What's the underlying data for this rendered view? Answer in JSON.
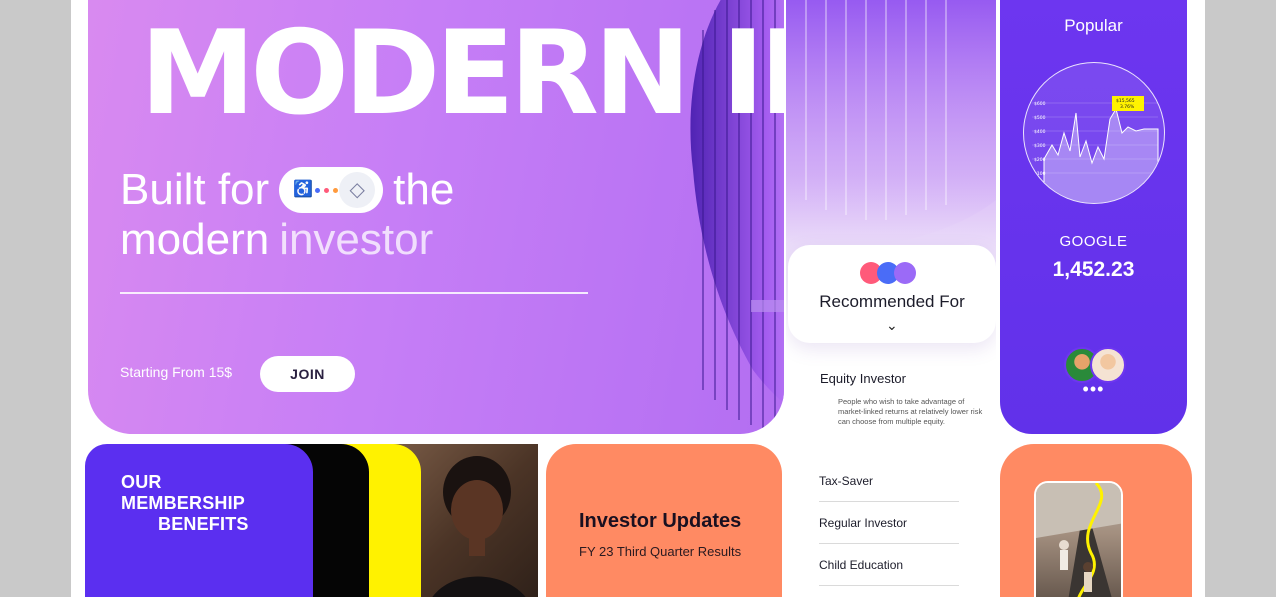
{
  "hero": {
    "title": "MODERN INVEST",
    "subtitle_line1_pre": "Built for",
    "subtitle_line1_post": "the",
    "subtitle_line2_main": "modern",
    "subtitle_line2_faded": "investor",
    "pill_chip": "♿",
    "starting_text": "Starting From 15$",
    "join_label": "JOIN"
  },
  "recommend": {
    "title": "Recommended For",
    "dot_colors": [
      "#ff5a7a",
      "#4a6cf7",
      "#9b6af7"
    ],
    "equity_title": "Equity Investor",
    "equity_desc": "People who wish to take advantage of market-linked returns at relatively lower risk can choose from multiple equity."
  },
  "popular": {
    "title": "Popular",
    "stock_name": "GOOGLE",
    "stock_value": "1,452.23",
    "chart_badge_value": "$15,565",
    "chart_badge_change": "3.76%",
    "chart_axis_labels": [
      "$600",
      "$500",
      "$400",
      "$300",
      "$200",
      "$100"
    ],
    "more": "•••"
  },
  "membership": {
    "line1": "OUR",
    "line2": "MEMBERSHIP",
    "line3": "BENEFITS"
  },
  "updates": {
    "title": "Investor Updates",
    "subtitle": "FY 23 Third Quarter Results"
  },
  "categories": [
    "Tax-Saver",
    "Regular Investor",
    "Child Education"
  ],
  "colors": {
    "hero_purple": "#c67ef6",
    "popular_purple": "#6e36f0",
    "membership_purple": "#5b2ff0",
    "accent_orange": "#ff8a63",
    "accent_yellow": "#fff200"
  }
}
